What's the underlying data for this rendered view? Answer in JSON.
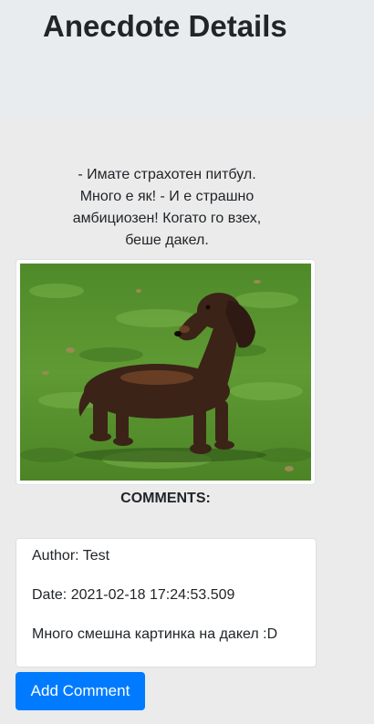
{
  "header": {
    "title": "Anecdote Details"
  },
  "anecdote": {
    "lines": [
      "- Имате страхотен питбул.",
      "Много е як! - И е страшно",
      "амбициозен! Когато го взех,",
      "беше дакел."
    ],
    "image_icon": "dachshund-photo"
  },
  "comments": {
    "heading": "COMMENTS:",
    "items": [
      {
        "author": "Author: Test",
        "date": "Date: 2021-02-18 17:24:53.509",
        "text": "Много смешна картинка на дакел :D"
      }
    ]
  },
  "actions": {
    "add_comment_label": "Add Comment"
  },
  "colors": {
    "primary": "#007bff",
    "header_bg": "#e9ecef",
    "page_bg": "#ebebeb"
  }
}
